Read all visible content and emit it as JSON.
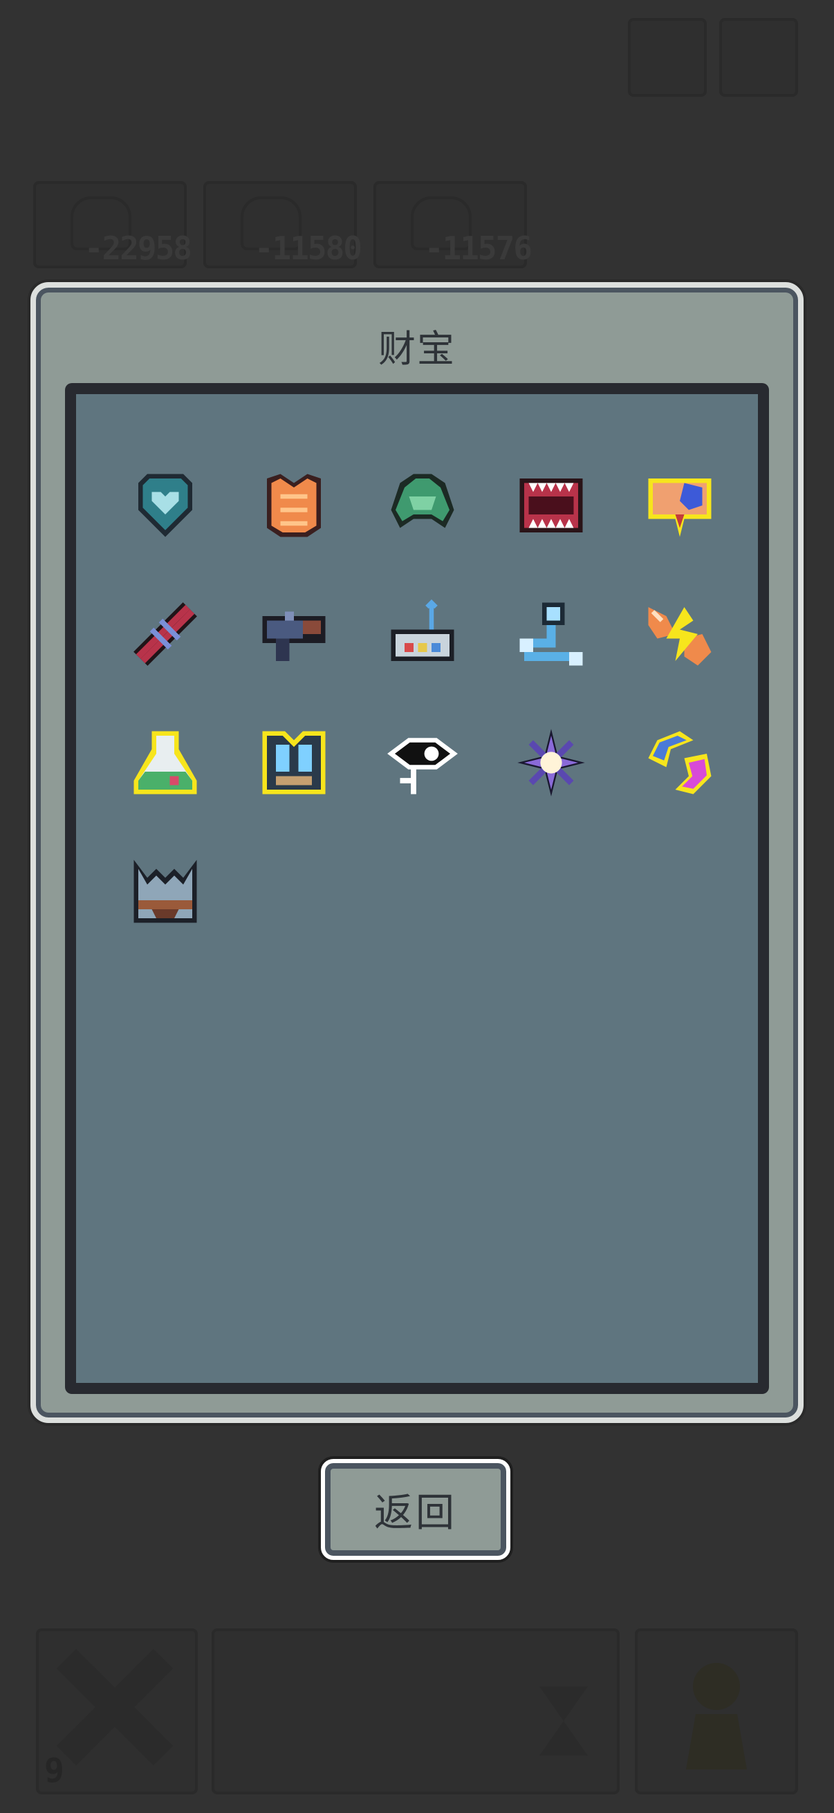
{
  "panel": {
    "title": "财宝"
  },
  "back_button": {
    "label": "返回"
  },
  "background": {
    "scores": [
      "-22958",
      "-11580",
      "-11576"
    ],
    "bottom_counter": "9"
  },
  "treasures": [
    {
      "icon": "teal-heart-shield-icon",
      "rarity": "normal"
    },
    {
      "icon": "orange-cat-armor-icon",
      "rarity": "normal"
    },
    {
      "icon": "green-turtle-shell-icon",
      "rarity": "normal"
    },
    {
      "icon": "monster-jaw-icon",
      "rarity": "normal"
    },
    {
      "icon": "blue-gem-scroll-icon",
      "rarity": "legendary"
    },
    {
      "icon": "red-dna-helix-icon",
      "rarity": "normal"
    },
    {
      "icon": "rocket-launcher-icon",
      "rarity": "normal"
    },
    {
      "icon": "antenna-radio-icon",
      "rarity": "normal"
    },
    {
      "icon": "blue-pipe-tool-icon",
      "rarity": "normal"
    },
    {
      "icon": "fox-lightning-icon",
      "rarity": "normal"
    },
    {
      "icon": "potion-flask-icon",
      "rarity": "legendary"
    },
    {
      "icon": "ice-armor-icon",
      "rarity": "legendary"
    },
    {
      "icon": "eye-key-icon",
      "rarity": "normal"
    },
    {
      "icon": "purple-star-icon",
      "rarity": "normal"
    },
    {
      "icon": "crescent-orb-icon",
      "rarity": "legendary"
    },
    {
      "icon": "spiked-helmet-icon",
      "rarity": "normal"
    }
  ],
  "colors": {
    "legendary_outline": "#f7e51c",
    "panel": "#8f9b96",
    "inner": "#5f757f"
  }
}
